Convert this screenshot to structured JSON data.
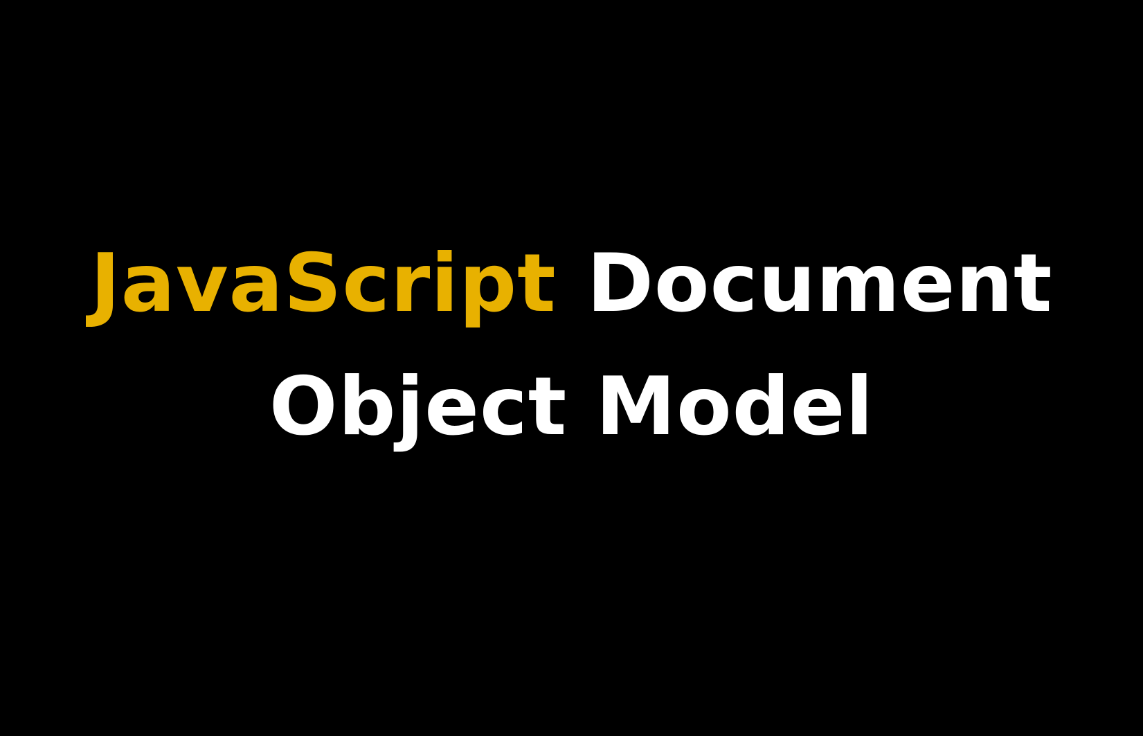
{
  "heading": {
    "accent_word": "JavaScript",
    "line1_rest": "Document",
    "line2": "Object Model"
  },
  "colors": {
    "background": "#000000",
    "accent": "#E8B100",
    "text": "#FFFFFF"
  }
}
